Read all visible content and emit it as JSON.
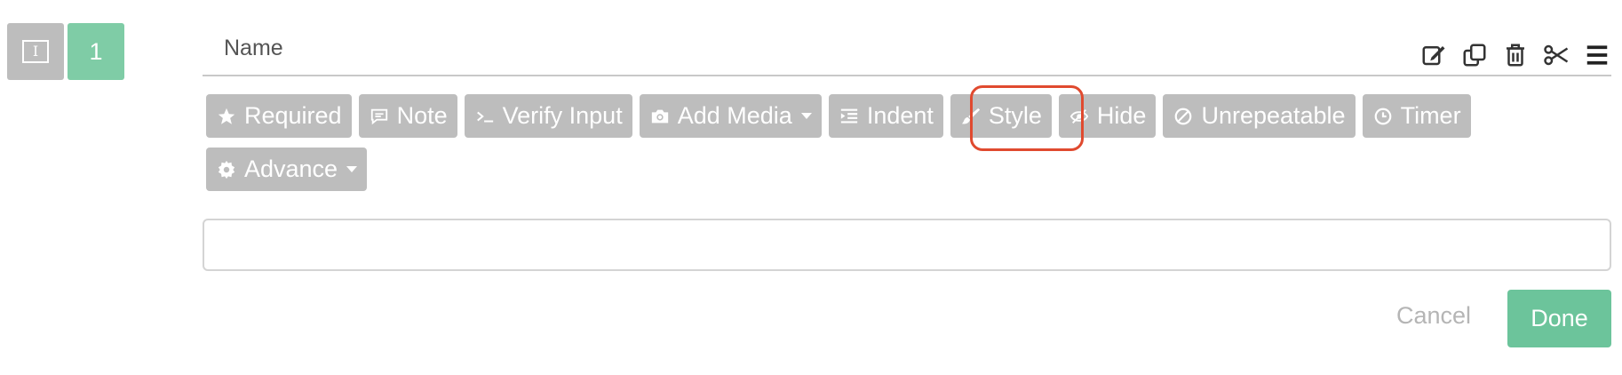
{
  "question": {
    "type_icon": "text-field-icon",
    "type_glyph": "I",
    "number": "1",
    "name_label": "Name"
  },
  "toolbar_icons": [
    "edit-icon",
    "duplicate-icon",
    "trash-icon",
    "scissors-icon",
    "menu-icon"
  ],
  "options": {
    "required": "Required",
    "note": "Note",
    "verify_input": "Verify Input",
    "add_media": "Add Media",
    "indent": "Indent",
    "style": "Style",
    "hide": "Hide",
    "unrepeatable": "Unrepeatable",
    "timer": "Timer",
    "advance": "Advance"
  },
  "highlighted_option": "style",
  "answer": {
    "value": "",
    "placeholder": ""
  },
  "actions": {
    "cancel": "Cancel",
    "done": "Done"
  },
  "colors": {
    "option_bg": "#bdbdbd",
    "number_badge": "#7fcca6",
    "done_button": "#6cc49b",
    "highlight_ring": "#e04a2f"
  }
}
